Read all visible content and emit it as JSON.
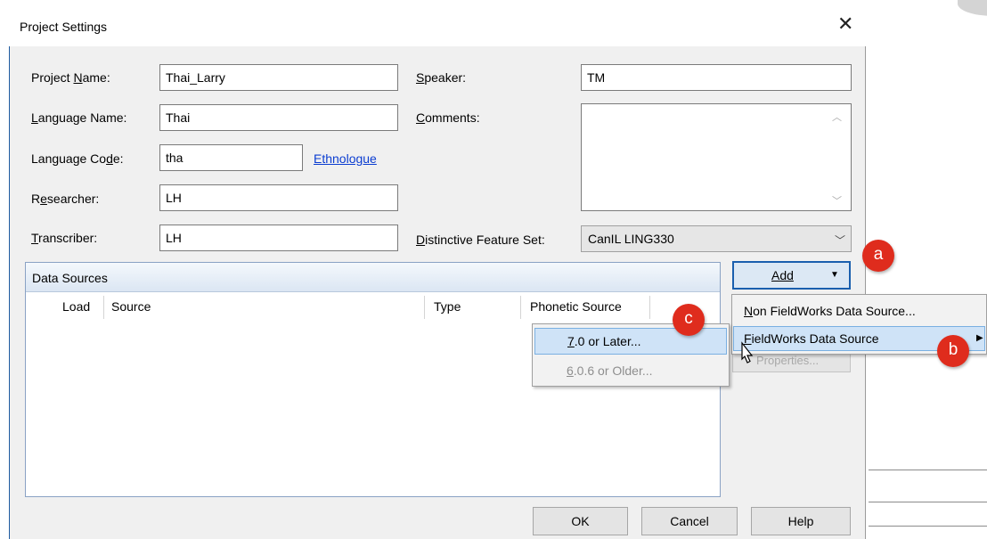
{
  "dialog": {
    "title": "Project Settings",
    "close_symbol": "✕"
  },
  "form": {
    "project_name": {
      "label_pre": "Project ",
      "label_key": "N",
      "label_post": "ame:",
      "value": "Thai_Larry"
    },
    "language_name": {
      "label_pre": "",
      "label_key": "L",
      "label_post": "anguage Name:",
      "value": "Thai"
    },
    "language_code": {
      "label_pre": "Language Co",
      "label_key": "d",
      "label_post": "e:",
      "value": "tha",
      "link": "Ethnologue"
    },
    "researcher": {
      "label_pre": "R",
      "label_key": "e",
      "label_post": "searcher:",
      "value": "LH"
    },
    "transcriber": {
      "label_pre": "",
      "label_key": "T",
      "label_post": "ranscriber:",
      "value": "LH"
    },
    "speaker": {
      "label_pre": "",
      "label_key": "S",
      "label_post": "peaker:",
      "value": "TM"
    },
    "comments": {
      "label_pre": "",
      "label_key": "C",
      "label_post": "omments:",
      "value": ""
    },
    "feature_set": {
      "label_pre": "",
      "label_key": "D",
      "label_post": "istinctive Feature Set:",
      "value": "CanIL LING330"
    }
  },
  "data_sources": {
    "header": "Data Sources",
    "columns": [
      "Load",
      "Source",
      "Type",
      "Phonetic Source"
    ]
  },
  "add_button": {
    "label": "Add",
    "arrow": "▼"
  },
  "properties_button": {
    "label": "Properties..."
  },
  "add_menu": {
    "items": [
      {
        "pre": "",
        "key": "N",
        "post": "on FieldWorks Data Source..."
      },
      {
        "pre": "",
        "key": "F",
        "post": "ieldWorks Data Source",
        "arrow": "▶"
      }
    ]
  },
  "fieldworks_submenu": {
    "items": [
      {
        "pre": "",
        "key": "7",
        "post": ".0 or Later...",
        "enabled": true
      },
      {
        "pre": "",
        "key": "6",
        "post": ".0.6 or Older...",
        "enabled": false
      }
    ]
  },
  "badges": [
    "a",
    "b",
    "c"
  ],
  "buttons": {
    "ok": "OK",
    "cancel": "Cancel",
    "help": "Help"
  },
  "colors": {
    "badge": "#df2c1d",
    "highlight": "#cfe3f7",
    "link": "#0b3dd1"
  }
}
